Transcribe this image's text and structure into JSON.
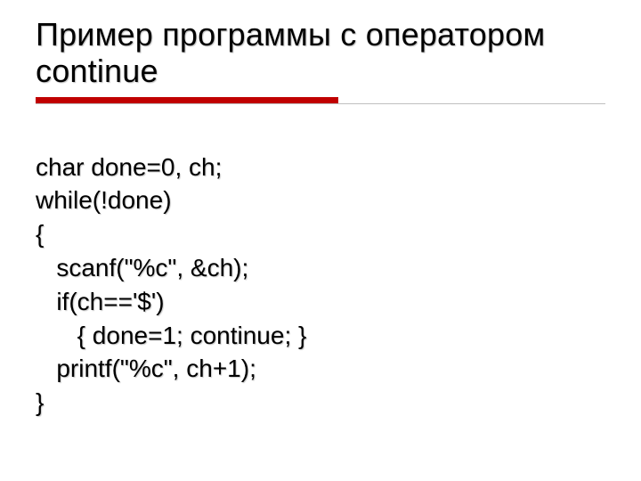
{
  "title": "Пример программы с оператором continue",
  "code": {
    "l1": "char done=0, ch;",
    "l2": "while(!done)",
    "l3": "{",
    "l4": "   scanf(\"%c\", &ch);",
    "l5": "   if(ch=='$')",
    "l6": "      { done=1; continue; }",
    "l7": "   printf(\"%c\", ch+1);",
    "l8": "}"
  }
}
